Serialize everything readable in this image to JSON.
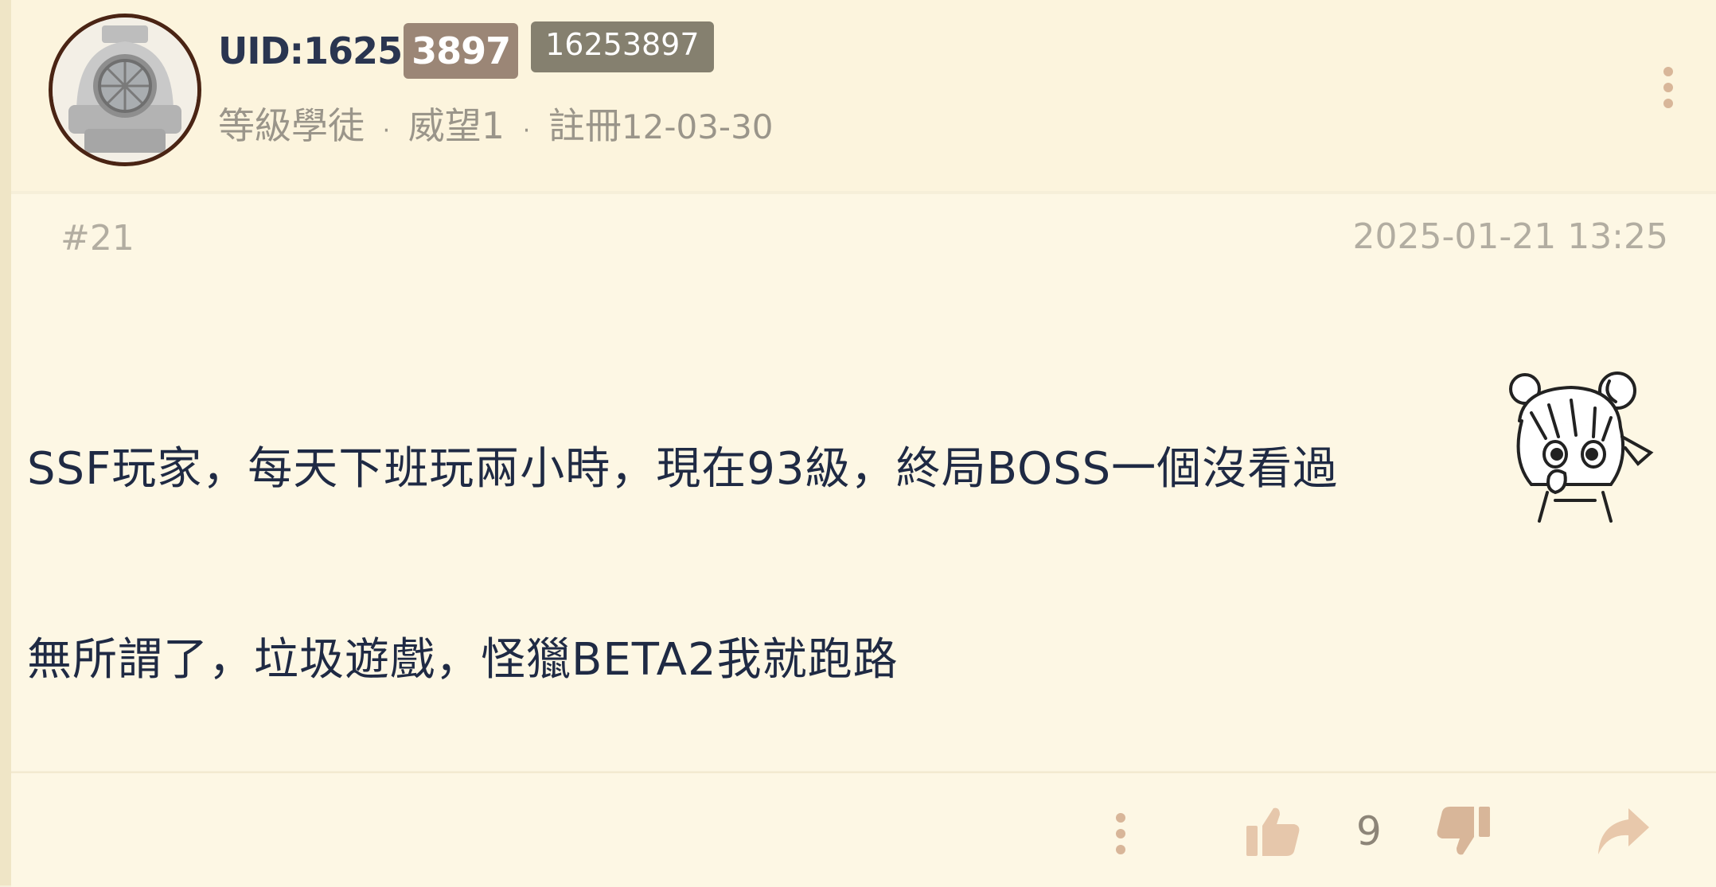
{
  "user": {
    "uid_prefix": "UID:1625",
    "uid_highlight": "3897",
    "uid_badge": "16253897",
    "level": "等級學徒",
    "sep1": "·",
    "reputation": "威望1",
    "sep2": "·",
    "reg_label": "註冊",
    "reg_date": "12-03-30"
  },
  "post": {
    "floor": "#21",
    "time": "2025-01-21 13:25",
    "line1": "SSF玩家，每天下班玩兩小時，現在93級，終局BOSS一個沒看過",
    "line2": "無所謂了，垃圾遊戲，怪獵BETA2我就跑路"
  },
  "actions": {
    "like_count": "9"
  },
  "icons": {
    "avatar": "diving-helmet-avatar",
    "more": "more-vertical-icon",
    "like": "thumbs-up-icon",
    "dislike": "thumbs-down-icon",
    "share": "share-arrow-icon"
  },
  "colors": {
    "background": "#fdf7e4",
    "header": "#fcf4dd",
    "accent": "#d8b699",
    "text": "#1f2a44"
  }
}
